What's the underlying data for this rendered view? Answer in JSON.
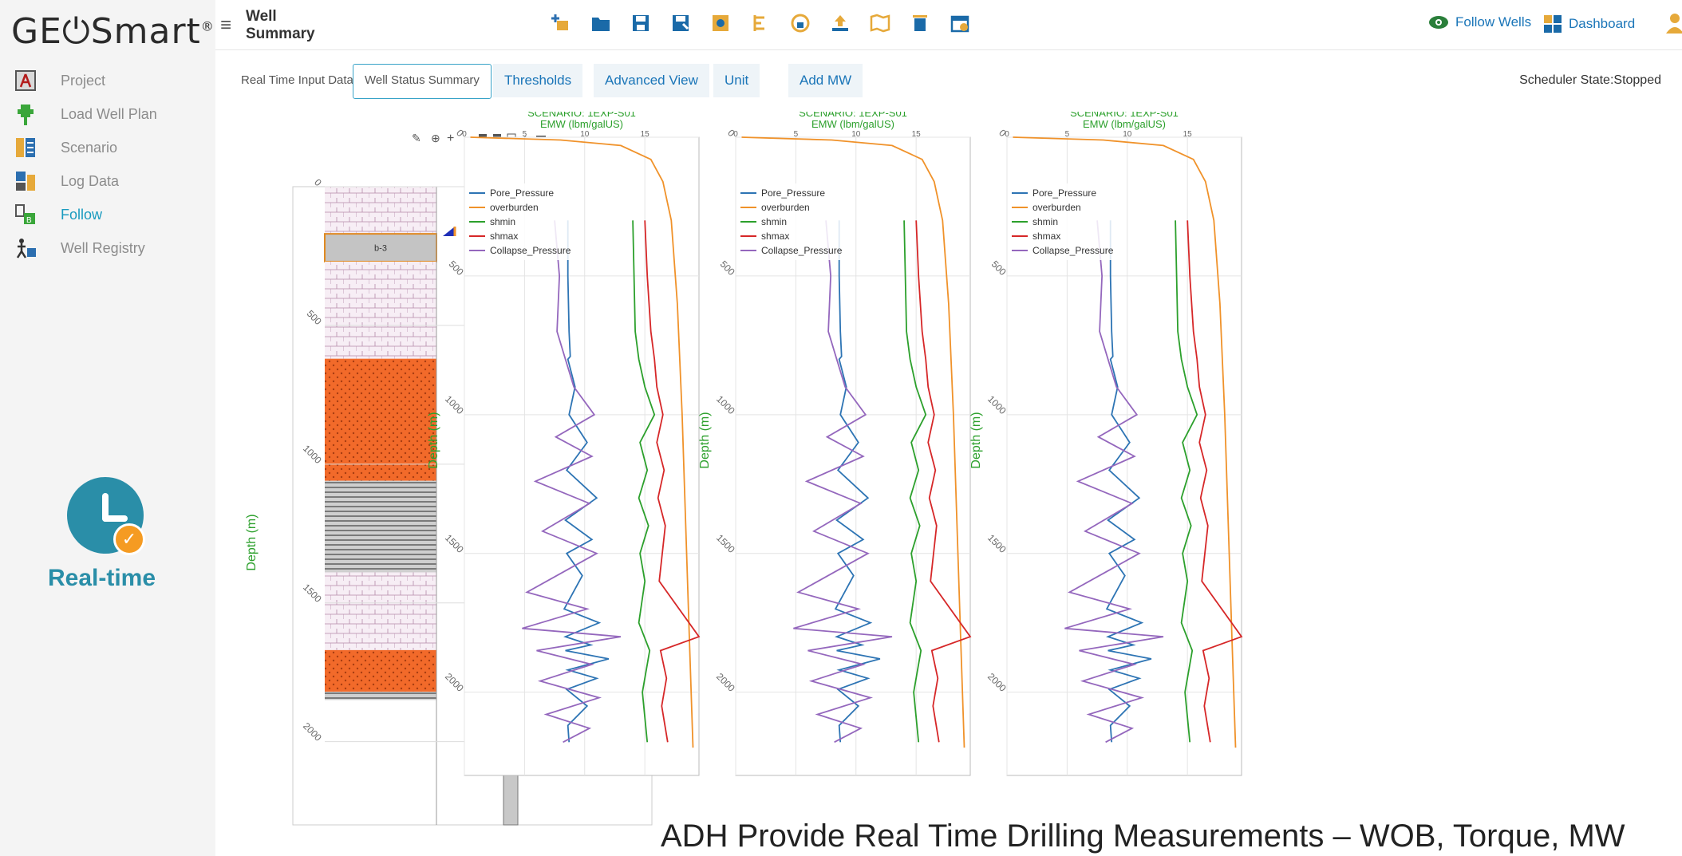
{
  "app": {
    "logo_text": "GE⏻Smart",
    "logo_reg": "®",
    "page_title": "Well Summary",
    "accent_color": "#1a9bbf",
    "brand_color": "#2a8ea8"
  },
  "sidebar": {
    "items": [
      {
        "label": "Project",
        "icon": "project-icon"
      },
      {
        "label": "Load Well Plan",
        "icon": "load-well-plan-icon"
      },
      {
        "label": "Scenario",
        "icon": "scenario-icon"
      },
      {
        "label": "Log Data",
        "icon": "log-data-icon"
      },
      {
        "label": "Follow",
        "icon": "follow-icon",
        "active": true
      },
      {
        "label": "Well Registry",
        "icon": "well-registry-icon"
      }
    ],
    "realtime_label": "Real-time"
  },
  "header": {
    "toolbar_icons": [
      "add-well-icon",
      "open-folder-icon",
      "save-icon",
      "save-as-icon",
      "settings-icon",
      "tree-icon",
      "lock-icon",
      "upload-icon",
      "map-icon",
      "delete-icon",
      "calendar-icon"
    ],
    "follow_wells": "Follow Wells",
    "dashboard": "Dashboard"
  },
  "tabs": {
    "items": [
      "Real Time Input Data",
      "Well Status Summary",
      "Thresholds",
      "Advanced View",
      "Unit",
      "Add MW"
    ],
    "selected": "Well Status Summary",
    "scheduler_state": "Scheduler State:Stopped"
  },
  "log_track": {
    "depth_label": "Depth (m)",
    "depth_ticks": [
      "0",
      "500",
      "1000",
      "1500",
      "2000"
    ],
    "formation_label": "b-3",
    "lithology": [
      {
        "from": 0,
        "to": 170,
        "type": "shale-pink"
      },
      {
        "from": 170,
        "to": 270,
        "type": "marker-gray",
        "label": "b-3"
      },
      {
        "from": 270,
        "to": 620,
        "type": "shale-pink"
      },
      {
        "from": 620,
        "to": 1060,
        "type": "sand-orange"
      },
      {
        "from": 1060,
        "to": 1390,
        "type": "gray-laminated"
      },
      {
        "from": 1390,
        "to": 1670,
        "type": "shale-pink"
      },
      {
        "from": 1670,
        "to": 1820,
        "type": "sand-orange"
      },
      {
        "from": 1820,
        "to": 1850,
        "type": "gray-laminated"
      }
    ]
  },
  "chart_data": [
    {
      "type": "line",
      "title": "SCENARIO: 1EXP-S01",
      "xlabel": "EMW (lbm/galUS)",
      "ylabel": "Depth (m)",
      "xticks": [
        "0",
        "5",
        "10",
        "15"
      ],
      "yticks": [
        "0",
        "500",
        "1000",
        "1500",
        "2000"
      ],
      "xlim": [
        0,
        19.5
      ],
      "ylim": [
        2300,
        0
      ],
      "legend_position": "top-left",
      "series": [
        {
          "name": "Pore_Pressure",
          "color": "#2d74b4",
          "x": [
            8.6,
            8.6,
            8.7,
            8.8,
            8.6,
            9.2,
            8.7,
            10.2,
            8.5,
            11.0,
            8.4,
            10.6,
            8.5,
            9.8,
            8.3,
            11.2,
            8.4,
            10.5,
            8.4,
            12.0,
            8.6,
            11.0,
            8.5,
            10.2,
            8.6,
            8.7
          ],
          "y": [
            300,
            500,
            700,
            790,
            800,
            900,
            1000,
            1100,
            1200,
            1300,
            1380,
            1450,
            1500,
            1580,
            1700,
            1750,
            1800,
            1830,
            1850,
            1880,
            1920,
            1950,
            1990,
            2050,
            2120,
            2180
          ]
        },
        {
          "name": "overburden",
          "color": "#f0922a",
          "x": [
            0.5,
            8.0,
            13.0,
            15.5,
            16.5,
            17.2,
            17.7,
            18.1,
            18.4,
            18.7,
            19.0
          ],
          "y": [
            0,
            10,
            30,
            80,
            160,
            300,
            600,
            1000,
            1400,
            1800,
            2200
          ]
        },
        {
          "name": "shmin",
          "color": "#2ca02c",
          "x": [
            14.0,
            14.1,
            14.2,
            14.5,
            15.0,
            15.8,
            14.6,
            15.2,
            14.5,
            15.3,
            14.6,
            15.0,
            14.5,
            15.4,
            14.8,
            15.2
          ],
          "y": [
            300,
            500,
            700,
            800,
            900,
            1000,
            1100,
            1200,
            1300,
            1400,
            1500,
            1600,
            1750,
            1850,
            2000,
            2180
          ]
        },
        {
          "name": "shmax",
          "color": "#d62728",
          "x": [
            15.0,
            15.2,
            15.5,
            15.8,
            16.0,
            16.5,
            16.0,
            16.6,
            16.1,
            16.7,
            16.2,
            19.5,
            16.3,
            16.8,
            16.4,
            16.9
          ],
          "y": [
            300,
            500,
            700,
            800,
            900,
            1000,
            1100,
            1200,
            1300,
            1400,
            1600,
            1800,
            1850,
            1950,
            2050,
            2180
          ]
        },
        {
          "name": "Collapse_Pressure",
          "color": "#9467bd",
          "x": [
            7.5,
            7.9,
            7.7,
            8.4,
            9.1,
            10.8,
            7.6,
            10.6,
            5.9,
            10.4,
            6.5,
            11.0,
            5.2,
            10.2,
            4.8,
            13.0,
            6.0,
            10.6,
            6.3,
            11.2,
            6.8,
            10.4,
            8.2
          ],
          "y": [
            300,
            500,
            700,
            800,
            900,
            1000,
            1080,
            1150,
            1240,
            1320,
            1420,
            1500,
            1640,
            1700,
            1770,
            1800,
            1850,
            1900,
            1960,
            2020,
            2080,
            2130,
            2180
          ]
        }
      ]
    },
    {
      "type": "line",
      "title": "SCENARIO: 1EXP-S01",
      "xlabel": "EMW (lbm/galUS)",
      "ylabel": "Depth (m)",
      "xticks": [
        "0",
        "5",
        "10",
        "15"
      ],
      "yticks": [
        "0",
        "500",
        "1000",
        "1500",
        "2000"
      ],
      "xlim": [
        0,
        19.5
      ],
      "ylim": [
        2300,
        0
      ],
      "legend_position": "top-left",
      "series": [
        {
          "name": "Pore_Pressure",
          "color": "#2d74b4",
          "x": [
            8.6,
            8.6,
            8.7,
            8.8,
            8.6,
            9.2,
            8.7,
            10.2,
            8.5,
            11.0,
            8.4,
            10.6,
            8.5,
            9.8,
            8.3,
            11.2,
            8.4,
            10.5,
            8.4,
            12.0,
            8.6,
            11.0,
            8.5,
            10.2,
            8.6,
            8.7
          ],
          "y": [
            300,
            500,
            700,
            790,
            800,
            900,
            1000,
            1100,
            1200,
            1300,
            1380,
            1450,
            1500,
            1580,
            1700,
            1750,
            1800,
            1830,
            1850,
            1880,
            1920,
            1950,
            1990,
            2050,
            2120,
            2180
          ]
        },
        {
          "name": "overburden",
          "color": "#f0922a",
          "x": [
            0.5,
            8.0,
            13.0,
            15.5,
            16.5,
            17.2,
            17.7,
            18.1,
            18.4,
            18.7,
            19.0
          ],
          "y": [
            0,
            10,
            30,
            80,
            160,
            300,
            600,
            1000,
            1400,
            1800,
            2200
          ]
        },
        {
          "name": "shmin",
          "color": "#2ca02c",
          "x": [
            14.0,
            14.1,
            14.2,
            14.5,
            15.0,
            15.8,
            14.6,
            15.2,
            14.5,
            15.3,
            14.6,
            15.0,
            14.5,
            15.4,
            14.8,
            15.2
          ],
          "y": [
            300,
            500,
            700,
            800,
            900,
            1000,
            1100,
            1200,
            1300,
            1400,
            1500,
            1600,
            1750,
            1850,
            2000,
            2180
          ]
        },
        {
          "name": "shmax",
          "color": "#d62728",
          "x": [
            15.0,
            15.2,
            15.5,
            15.8,
            16.0,
            16.5,
            16.0,
            16.6,
            16.1,
            16.7,
            16.2,
            19.5,
            16.3,
            16.8,
            16.4,
            16.9
          ],
          "y": [
            300,
            500,
            700,
            800,
            900,
            1000,
            1100,
            1200,
            1300,
            1400,
            1600,
            1800,
            1850,
            1950,
            2050,
            2180
          ]
        },
        {
          "name": "Collapse_Pressure",
          "color": "#9467bd",
          "x": [
            7.5,
            7.9,
            7.7,
            8.4,
            9.1,
            10.8,
            7.6,
            10.6,
            5.9,
            10.4,
            6.5,
            11.0,
            5.2,
            10.2,
            4.8,
            13.0,
            6.0,
            10.6,
            6.3,
            11.2,
            6.8,
            10.4,
            8.2
          ],
          "y": [
            300,
            500,
            700,
            800,
            900,
            1000,
            1080,
            1150,
            1240,
            1320,
            1420,
            1500,
            1640,
            1700,
            1770,
            1800,
            1850,
            1900,
            1960,
            2020,
            2080,
            2130,
            2180
          ]
        }
      ]
    },
    {
      "type": "line",
      "title": "SCENARIO: 1EXP-S01",
      "xlabel": "EMW (lbm/galUS)",
      "ylabel": "Depth (m)",
      "xticks": [
        "0",
        "5",
        "10",
        "15"
      ],
      "yticks": [
        "0",
        "500",
        "1000",
        "1500",
        "2000"
      ],
      "xlim": [
        0,
        19.5
      ],
      "ylim": [
        2300,
        0
      ],
      "legend_position": "top-left",
      "series": [
        {
          "name": "Pore_Pressure",
          "color": "#2d74b4",
          "x": [
            8.6,
            8.6,
            8.7,
            8.8,
            8.6,
            9.2,
            8.7,
            10.2,
            8.5,
            11.0,
            8.4,
            10.6,
            8.5,
            9.8,
            8.3,
            11.2,
            8.4,
            10.5,
            8.4,
            12.0,
            8.6,
            11.0,
            8.5,
            10.2,
            8.6,
            8.7
          ],
          "y": [
            300,
            500,
            700,
            790,
            800,
            900,
            1000,
            1100,
            1200,
            1300,
            1380,
            1450,
            1500,
            1580,
            1700,
            1750,
            1800,
            1830,
            1850,
            1880,
            1920,
            1950,
            1990,
            2050,
            2120,
            2180
          ]
        },
        {
          "name": "overburden",
          "color": "#f0922a",
          "x": [
            0.5,
            8.0,
            13.0,
            15.5,
            16.5,
            17.2,
            17.7,
            18.1,
            18.4,
            18.7,
            19.0
          ],
          "y": [
            0,
            10,
            30,
            80,
            160,
            300,
            600,
            1000,
            1400,
            1800,
            2200
          ]
        },
        {
          "name": "shmin",
          "color": "#2ca02c",
          "x": [
            14.0,
            14.1,
            14.2,
            14.5,
            15.0,
            15.8,
            14.6,
            15.2,
            14.5,
            15.3,
            14.6,
            15.0,
            14.5,
            15.4,
            14.8,
            15.2
          ],
          "y": [
            300,
            500,
            700,
            800,
            900,
            1000,
            1100,
            1200,
            1300,
            1400,
            1500,
            1600,
            1750,
            1850,
            2000,
            2180
          ]
        },
        {
          "name": "shmax",
          "color": "#d62728",
          "x": [
            15.0,
            15.2,
            15.5,
            15.8,
            16.0,
            16.5,
            16.0,
            16.6,
            16.1,
            16.7,
            16.2,
            19.5,
            16.3,
            16.8,
            16.4,
            16.9
          ],
          "y": [
            300,
            500,
            700,
            800,
            900,
            1000,
            1100,
            1200,
            1300,
            1400,
            1600,
            1800,
            1850,
            1950,
            2050,
            2180
          ]
        },
        {
          "name": "Collapse_Pressure",
          "color": "#9467bd",
          "x": [
            7.5,
            7.9,
            7.7,
            8.4,
            9.1,
            10.8,
            7.6,
            10.6,
            5.9,
            10.4,
            6.5,
            11.0,
            5.2,
            10.2,
            4.8,
            13.0,
            6.0,
            10.6,
            6.3,
            11.2,
            6.8,
            10.4,
            8.2
          ],
          "y": [
            300,
            500,
            700,
            800,
            900,
            1000,
            1080,
            1150,
            1240,
            1320,
            1420,
            1500,
            1640,
            1700,
            1770,
            1800,
            1850,
            1900,
            1960,
            2020,
            2080,
            2130,
            2180
          ]
        }
      ]
    }
  ],
  "footer": {
    "caption": "ADH Provide Real Time Drilling Measurements – WOB, Torque, MW"
  }
}
